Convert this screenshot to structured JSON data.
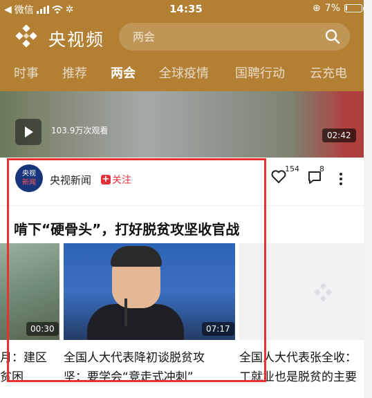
{
  "status_bar": {
    "carrier": "微信",
    "time": "14:35",
    "battery": "7%",
    "battery_level": 0.07
  },
  "header": {
    "brand": "央视频",
    "search": {
      "placeholder": "两会",
      "value": ""
    }
  },
  "tabs": [
    {
      "label": "时事",
      "active": false
    },
    {
      "label": "推荐",
      "active": false
    },
    {
      "label": "两会",
      "active": true
    },
    {
      "label": "全球疫情",
      "active": false
    },
    {
      "label": "国聘行动",
      "active": false
    },
    {
      "label": "云充电",
      "active": false
    }
  ],
  "banner": {
    "views": "103.9万次观看",
    "duration": "02:42"
  },
  "card": {
    "avatar_line1": "央视",
    "avatar_line2": "新闻",
    "author": "央视新闻",
    "follow_label": "关注",
    "likes": "154",
    "comments": "8",
    "headline": "啃下“硬骨头”，打好脱贫攻坚收官战"
  },
  "videos": [
    {
      "duration": "00:30",
      "caption_line1": "月：建区",
      "caption_line2": "贫困"
    },
    {
      "duration": "07:17",
      "caption_line1": "全国人大代表降初谈脱贫攻",
      "caption_line2": "坚：要学会“竞走式冲刺”"
    },
    {
      "caption_line1": "全国人大代表张全收：",
      "caption_line2": "工就业也是脱贫的主要"
    }
  ],
  "colors": {
    "header_bg": "#b27f33",
    "accent_red": "#e0303a",
    "highlight": "#e8312f"
  }
}
